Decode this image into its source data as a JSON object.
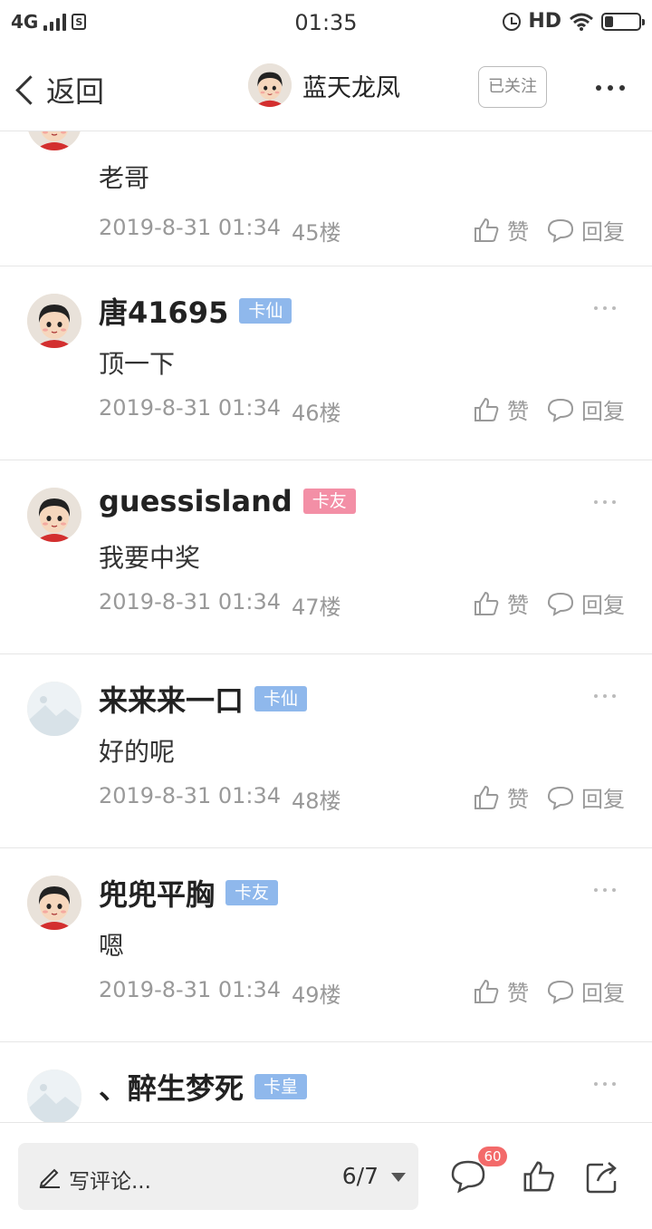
{
  "status_bar": {
    "network": "4G",
    "sim_label": "S",
    "time": "01:35",
    "hd": "HD",
    "battery_level": 0.25
  },
  "header": {
    "back_label": "返回",
    "user_name": "蓝天龙凤",
    "follow_label": "已关注"
  },
  "partial_top_comment": {
    "text": "老哥",
    "date": "2019-8-31 01:34",
    "floor": "45楼",
    "like_label": "赞",
    "reply_label": "回复"
  },
  "comments": [
    {
      "user": "唐41695",
      "badge": "卡仙",
      "badge_color": "#8fb8ec",
      "text": "顶一下",
      "date": "2019-8-31 01:34",
      "floor": "46楼",
      "like_label": "赞",
      "reply_label": "回复",
      "avatar": "girl-avatar"
    },
    {
      "user": "guessisland",
      "badge": "卡友",
      "badge_color": "#f38fa6",
      "text": "我要中奖",
      "date": "2019-8-31 01:34",
      "floor": "47楼",
      "like_label": "赞",
      "reply_label": "回复",
      "avatar": "girl-avatar"
    },
    {
      "user": "来来来一口",
      "badge": "卡仙",
      "badge_color": "#8fb8ec",
      "text": "好的呢",
      "date": "2019-8-31 01:34",
      "floor": "48楼",
      "like_label": "赞",
      "reply_label": "回复",
      "avatar": "placeholder-avatar"
    },
    {
      "user": "兜兜平胸",
      "badge": "卡友",
      "badge_color": "#8fb8ec",
      "text": "嗯",
      "date": "2019-8-31 01:34",
      "floor": "49楼",
      "like_label": "赞",
      "reply_label": "回复",
      "avatar": "girl-avatar"
    },
    {
      "user": "、醉生梦死",
      "badge": "卡皇",
      "badge_color": "#8fb8ec",
      "avatar": "placeholder-avatar"
    }
  ],
  "bottom_bar": {
    "compose_placeholder": "写评论...",
    "page_indicator": "6/7",
    "comment_count": "60"
  },
  "colors": {
    "badge_blue": "#8fb8ec",
    "badge_pink": "#f38fa6",
    "count_badge": "#f36a6a"
  }
}
